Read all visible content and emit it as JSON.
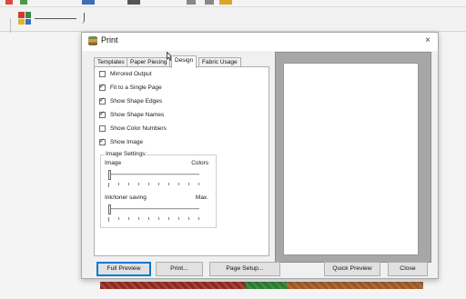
{
  "dialog": {
    "title": "Print",
    "close_glyph": "×",
    "tabs": [
      {
        "label": "Templates",
        "active": false
      },
      {
        "label": "Paper Piecing",
        "active": false
      },
      {
        "label": "Design",
        "active": true
      },
      {
        "label": "Fabric Usage",
        "active": false
      }
    ],
    "options": [
      {
        "label": "Mirrored Output",
        "checked": false
      },
      {
        "label": "Fit to a Single Page",
        "checked": true
      },
      {
        "label": "Show Shape Edges",
        "checked": true
      },
      {
        "label": "Show Shape Names",
        "checked": true
      },
      {
        "label": "Show Color Numbers",
        "checked": false
      },
      {
        "label": "Show Image",
        "checked": true
      }
    ],
    "image_settings": {
      "group_label": "Image Settings:",
      "image_slider": {
        "left_label": "Image",
        "right_label": "Colors",
        "position": 0.0
      },
      "ink_slider": {
        "left_label": "Ink/toner saving",
        "right_label": "Max.",
        "position": 0.0
      }
    },
    "buttons": {
      "full_preview": "Full Preview",
      "print": "Print...",
      "page_setup": "Page Setup...",
      "quick_preview": "Quick Preview",
      "close": "Close"
    }
  },
  "icons": {
    "title_icon": "quilt-app-icon",
    "close": "close-icon",
    "cursor": "mouse-pointer-icon",
    "palette": "color-palette-icon",
    "line": "line-tool-icon"
  },
  "colors": {
    "accent": "#0078d7",
    "preview_frame": "#a7a7a7",
    "palette": [
      "#d33a2c",
      "#3b8a3e",
      "#e0b52a",
      "#3b6fc4"
    ],
    "quilt_strip": [
      "#8b2a24",
      "#2f7a34",
      "#9a5a2a"
    ]
  }
}
